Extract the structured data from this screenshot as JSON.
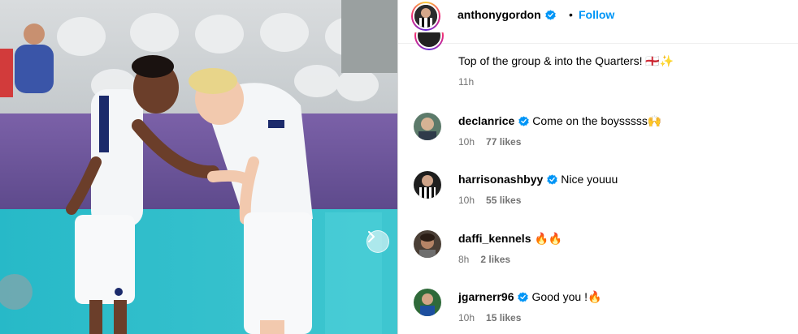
{
  "header": {
    "username": "anthonygordon",
    "separator": "•",
    "follow_label": "Follow"
  },
  "caption": {
    "text": "Top of the group & into the Quarters! 🏴󠁧󠁢󠁥󠁮󠁧󠁿✨",
    "time": "11h"
  },
  "comments": [
    {
      "username": "declanrice",
      "verified": true,
      "text": "Come on the boysssss🙌",
      "time": "10h",
      "likes": "77 likes"
    },
    {
      "username": "harrisonashbyy",
      "verified": true,
      "text": "Nice youuu",
      "time": "10h",
      "likes": "55 likes"
    },
    {
      "username": "daffi_kennels",
      "verified": false,
      "text": "🔥🔥",
      "time": "8h",
      "likes": "2 likes"
    },
    {
      "username": "jgarnerr96",
      "verified": true,
      "text": "Good you !🔥",
      "time": "10h",
      "likes": "15 likes"
    }
  ],
  "icons": {
    "verified": "verified-badge-icon",
    "next": "chevron-right-icon"
  },
  "colors": {
    "follow": "#0095f6",
    "verified": "#0095f6",
    "meta": "#737373"
  }
}
